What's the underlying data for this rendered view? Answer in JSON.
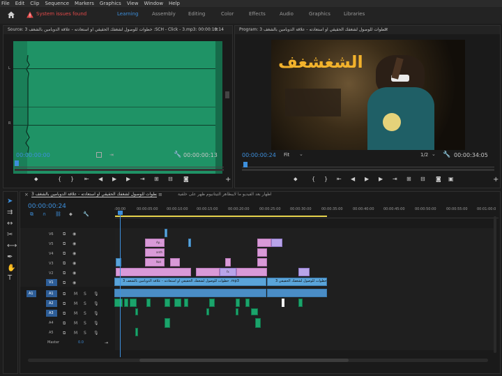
{
  "menu": [
    "File",
    "Edit",
    "Clip",
    "Sequence",
    "Markers",
    "Graphics",
    "View",
    "Window",
    "Help"
  ],
  "alert": "System issues found",
  "workspaces": [
    "Learning",
    "Assembly",
    "Editing",
    "Color",
    "Effects",
    "Audio",
    "Graphics",
    "Libraries"
  ],
  "active_workspace": "Learning",
  "source": {
    "title": "Source: خطوات للوصول لشغفك الحقيقي او استعادته - علاقة الدوبامين بالشغف 3 :SCH - Click - 3.mp3: 00:00:10:14",
    "timecode_in": "00:00:00:00",
    "timecode_out": "00:00:00:13",
    "channels": [
      "L",
      "R"
    ]
  },
  "program": {
    "title": "Program: خطوات للوصول لشغفك الحقيقي او استعادته - علاقة الدوبامين بالشغف 3",
    "timecode": "00:00:00:24",
    "fit": "Fit",
    "ratio": "1/2",
    "duration": "00:00:34:05",
    "overlay_text": "الشغشغف"
  },
  "timeline": {
    "tab1": "خطوات للوصول لشغفك الحقيقي او استعادته - علاقة الدوبامين بالشغف 3",
    "tab2": "اظهار بعد الفيديو ما لايبظاهر التيتانيوم ظهر على خلفية",
    "timecode": "00:00:00:24",
    "ruler": [
      ":00:00",
      "00:00:05:00",
      "00:00:10:00",
      "00:00:15:00",
      "00:00:20:00",
      "00:00:25:00",
      "00:00:30:00",
      "00:00:35:00",
      "00:00:40:00",
      "00:00:45:00",
      "00:00:50:00",
      "00:00:55:00",
      "00:01:00:0"
    ],
    "video_tracks": [
      "V6",
      "V5",
      "V4",
      "V3",
      "V2",
      "V1"
    ],
    "audio_tracks": [
      "A1",
      "A2",
      "A3",
      "A4",
      "A5"
    ],
    "source_patch_v": "V1",
    "source_patch_a": "A1",
    "master": "Master",
    "master_value": "0.0",
    "clip_labels": [
      "Ap..",
      "anth",
      "Not",
      "fx",
      "fx",
      "خطوات للوصول لشغفك الحقيقي او استعادته - علاقة الدوبامين بالشغف 3 .mp3",
      "خطوات للوصول لشغفك الحقيقي 3"
    ],
    "mute": "M",
    "solo": "S"
  }
}
